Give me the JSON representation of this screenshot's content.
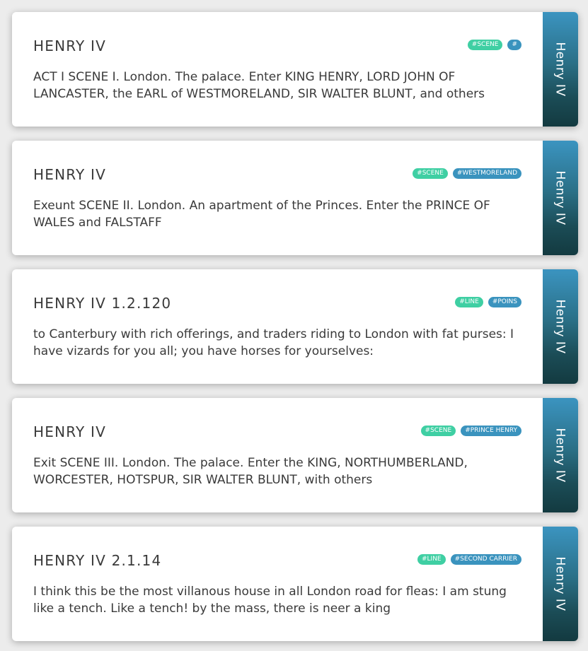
{
  "colors": {
    "tag_scene_line": "#3fcfa3",
    "tag_character": "#3a93be",
    "side_tab_top": "#3b94c0",
    "side_tab_bottom": "#133a40"
  },
  "cards": [
    {
      "title": "HENRY IV",
      "tags": [
        "#SCENE",
        "#"
      ],
      "text": "ACT I SCENE I. London. The palace. Enter KING HENRY, LORD JOHN OF LANCASTER, the EARL of WESTMORELAND, SIR WALTER BLUNT, and others",
      "side_label": "Henry IV"
    },
    {
      "title": "HENRY IV",
      "tags": [
        "#SCENE",
        "#WESTMORELAND"
      ],
      "text": "Exeunt SCENE II. London. An apartment of the Princes. Enter the PRINCE OF WALES and FALSTAFF",
      "side_label": "Henry IV"
    },
    {
      "title": "HENRY IV 1.2.120",
      "tags": [
        "#LINE",
        "#POINS"
      ],
      "text": "to Canterbury with rich offerings, and traders riding to London with fat purses: I have vizards for you all; you have horses for yourselves:",
      "side_label": "Henry IV"
    },
    {
      "title": "HENRY IV",
      "tags": [
        "#SCENE",
        "#PRINCE HENRY"
      ],
      "text": "Exit SCENE III. London. The palace. Enter the KING, NORTHUMBERLAND, WORCESTER, HOTSPUR, SIR WALTER BLUNT, with others",
      "side_label": "Henry IV"
    },
    {
      "title": "HENRY IV 2.1.14",
      "tags": [
        "#LINE",
        "#SECOND CARRIER"
      ],
      "text": "I think this be the most villanous house in all London road for fleas: I am stung like a tench. Like a tench! by the mass, there is neer a king",
      "side_label": "Henry IV"
    }
  ]
}
